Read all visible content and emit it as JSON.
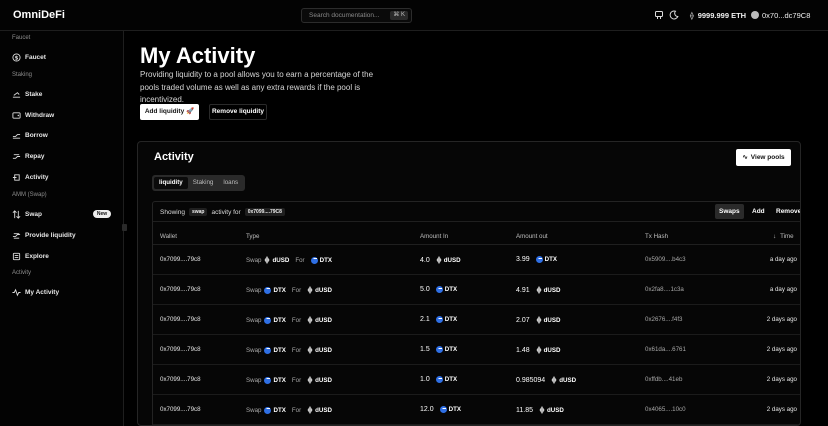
{
  "app": {
    "logo": "OmniDeFi"
  },
  "topbar": {
    "search_placeholder": "Search documentation...",
    "search_shortcut": "⌘ K",
    "eth_balance": "9999.999 ETH",
    "address": "0x70...dc79C8"
  },
  "sidebar": {
    "sections": [
      {
        "label": "Faucet"
      },
      {
        "label": "Staking"
      },
      {
        "label": "AMM (Swap)"
      },
      {
        "label": "Activity"
      }
    ],
    "items": [
      {
        "label": "Faucet",
        "icon": "dollar-circle-icon"
      },
      {
        "label": "Stake",
        "icon": "stake-icon"
      },
      {
        "label": "Withdraw",
        "icon": "wallet-icon"
      },
      {
        "label": "Borrow",
        "icon": "borrow-icon"
      },
      {
        "label": "Repay",
        "icon": "repay-icon"
      },
      {
        "label": "Activity",
        "icon": "activity-icon"
      },
      {
        "label": "Swap",
        "icon": "swap-icon",
        "badge": "New"
      },
      {
        "label": "Provide liquidity",
        "icon": "liquidity-icon"
      },
      {
        "label": "Explore",
        "icon": "explore-icon"
      },
      {
        "label": "My Activity",
        "icon": "pulse-icon"
      }
    ]
  },
  "page": {
    "title": "My Activity",
    "description": "Providing liquidity to a pool allows you to earn a percentage of the pools traded volume as well as any extra rewards if the pool is incentivized.",
    "add_liquidity": "Add liquidity 🚀",
    "remove_liquidity": "Remove liquidity"
  },
  "activity": {
    "title": "Activity",
    "view_pools": "View pools",
    "tabs": [
      "liquidity",
      "Staking",
      "loans"
    ],
    "showing_prefix": "Showing",
    "showing_type": "swap",
    "showing_mid": "activity for",
    "showing_addr": "0x7099....79C8",
    "filters": [
      "Swaps",
      "Add",
      "Remove"
    ],
    "columns": [
      "Wallet",
      "Type",
      "Amount In",
      "Amount out",
      "Tx Hash",
      "Time"
    ],
    "rows": [
      {
        "wallet": "0x7099....79c8",
        "type": "Swap",
        "from": "dUSD",
        "for": "For",
        "to": "DTX",
        "in_amt": "4.0",
        "in_tok": "dUSD",
        "out_amt": "3.99",
        "out_tok": "DTX",
        "hash": "0x5909....b4c3",
        "time": "a day ago"
      },
      {
        "wallet": "0x7099....79c8",
        "type": "Swap",
        "from": "DTX",
        "for": "For",
        "to": "dUSD",
        "in_amt": "5.0",
        "in_tok": "DTX",
        "out_amt": "4.91",
        "out_tok": "dUSD",
        "hash": "0x2fa8....1c3a",
        "time": "a day ago"
      },
      {
        "wallet": "0x7099....79c8",
        "type": "Swap",
        "from": "DTX",
        "for": "For",
        "to": "dUSD",
        "in_amt": "2.1",
        "in_tok": "DTX",
        "out_amt": "2.07",
        "out_tok": "dUSD",
        "hash": "0x2676....f4f3",
        "time": "2 days ago"
      },
      {
        "wallet": "0x7099....79c8",
        "type": "Swap",
        "from": "DTX",
        "for": "For",
        "to": "dUSD",
        "in_amt": "1.5",
        "in_tok": "DTX",
        "out_amt": "1.48",
        "out_tok": "dUSD",
        "hash": "0x61da....6761",
        "time": "2 days ago"
      },
      {
        "wallet": "0x7099....79c8",
        "type": "Swap",
        "from": "DTX",
        "for": "For",
        "to": "dUSD",
        "in_amt": "1.0",
        "in_tok": "DTX",
        "out_amt": "0.985094",
        "out_tok": "dUSD",
        "hash": "0xffdb....41eb",
        "time": "2 days ago"
      },
      {
        "wallet": "0x7099....79c8",
        "type": "Swap",
        "from": "DTX",
        "for": "For",
        "to": "dUSD",
        "in_amt": "12.0",
        "in_tok": "DTX",
        "out_amt": "11.85",
        "out_tok": "dUSD",
        "hash": "0x4065....10c0",
        "time": "2 days ago"
      }
    ]
  }
}
